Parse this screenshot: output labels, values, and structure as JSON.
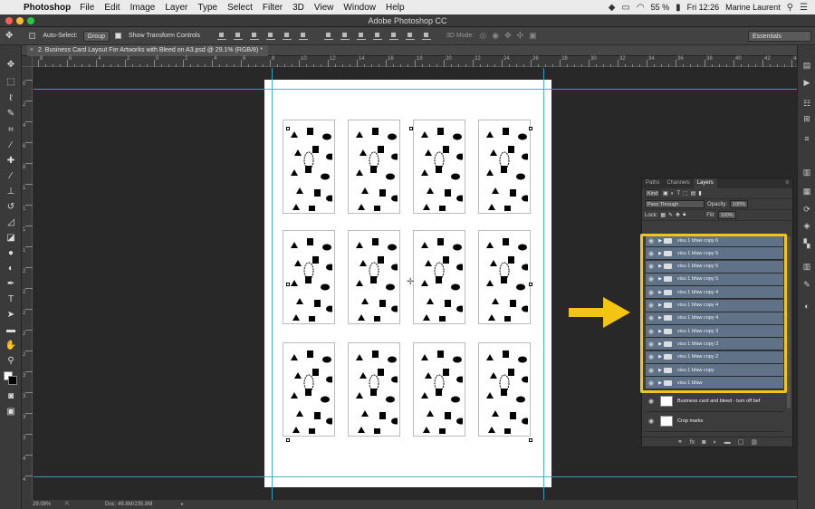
{
  "menubar": {
    "app_name": "Photoshop",
    "items": [
      "File",
      "Edit",
      "Image",
      "Layer",
      "Type",
      "Select",
      "Filter",
      "3D",
      "View",
      "Window",
      "Help"
    ],
    "battery": "55 %",
    "clock": "Fri 12:26",
    "user": "Marine Laurent"
  },
  "window": {
    "title": "Adobe Photoshop CC"
  },
  "options_bar": {
    "auto_select_label": "Auto-Select:",
    "auto_select_value": "Group",
    "show_transform_label": "Show Transform Controls",
    "mode_3d_label": "3D Mode:",
    "workspace": "Essentials"
  },
  "document": {
    "tab_title": "2. Business Card Layout For Artworks with Bleed on A3.psd @ 29.1% (RGB/8) *",
    "zoom": "29.08%",
    "doc_size": "Doc: 49.8M/235.8M"
  },
  "rulers": {
    "h_labels": [
      "8",
      "6",
      "4",
      "2",
      "0",
      "2",
      "4",
      "6",
      "8",
      "10",
      "12",
      "14",
      "16",
      "18",
      "20",
      "22",
      "24",
      "26",
      "28",
      "30",
      "32",
      "34",
      "36",
      "38",
      "40",
      "42",
      "44"
    ],
    "v_labels": [
      "0",
      "2",
      "4",
      "6",
      "8",
      "1",
      "1",
      "1",
      "1",
      "2",
      "2",
      "2",
      "2",
      "2",
      "3",
      "3",
      "3",
      "3",
      "4",
      "4"
    ]
  },
  "layers_panel": {
    "tabs": [
      "Paths",
      "Channels",
      "Layers"
    ],
    "active_tab": "Layers",
    "filter_kind": "Kind",
    "blend_mode": "Pass Through",
    "opacity_label": "Opacity:",
    "opacity_value": "100%",
    "lock_label": "Lock:",
    "fill_label": "Fill:",
    "fill_value": "100%",
    "groups": [
      {
        "name": "visu 1 bfaw copy 6"
      },
      {
        "name": "visu 1 bfaw copy 5"
      },
      {
        "name": "visu 1 bfaw copy 5"
      },
      {
        "name": "visu 1 bfaw copy 5"
      },
      {
        "name": "visu 1 bfaw copy 4"
      },
      {
        "name": "visu 1 bfaw copy 4"
      },
      {
        "name": "visu 1 bfaw copy 4"
      },
      {
        "name": "visu 1 bfaw copy 3"
      },
      {
        "name": "visu 1 bfaw copy 3"
      },
      {
        "name": "visu 1 bfaw copy 2"
      },
      {
        "name": "visu 1 bfaw copy"
      },
      {
        "name": "visu 1 bfaw"
      }
    ],
    "layers": [
      {
        "name": "Business card and bleed - turn off bef"
      },
      {
        "name": "Crop marks"
      }
    ]
  },
  "colors": {
    "highlight": "#f3c413",
    "guide": "#3aa7c8",
    "selection": "#5f7288"
  }
}
